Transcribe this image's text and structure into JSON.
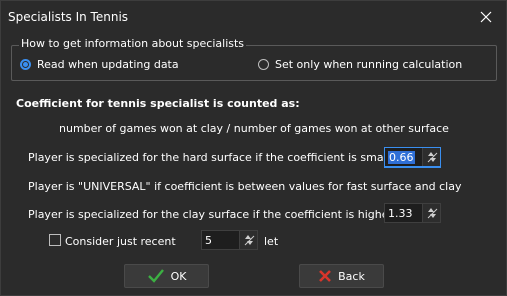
{
  "window": {
    "title": "Specialists In Tennis"
  },
  "source_group": {
    "legend": "How to get information about specialists",
    "option_read": "Read when updating data",
    "option_set": "Set only when running calculation",
    "selected": "read"
  },
  "heading": "Coefficient for tennis specialist is counted as:",
  "formula": "number of games won at clay / number of games won at other surface",
  "hard_label": "Player is specialized for the hard surface if the coefficient is smaller th",
  "hard_value": "0.66",
  "universal_label": "Player is \"UNIVERSAL\" if coefficient is between values for fast surface and clay",
  "clay_label": "Player is specialized for the clay surface if the coefficient is higher tha",
  "clay_value": "1.33",
  "recent": {
    "checkbox_label": "Consider just recent",
    "checked": false,
    "value": "5",
    "unit": "let"
  },
  "buttons": {
    "ok": "OK",
    "back": "Back"
  },
  "colors": {
    "accent": "#3a8ff0",
    "ok_check": "#3cb043",
    "back_x": "#d9352b"
  }
}
